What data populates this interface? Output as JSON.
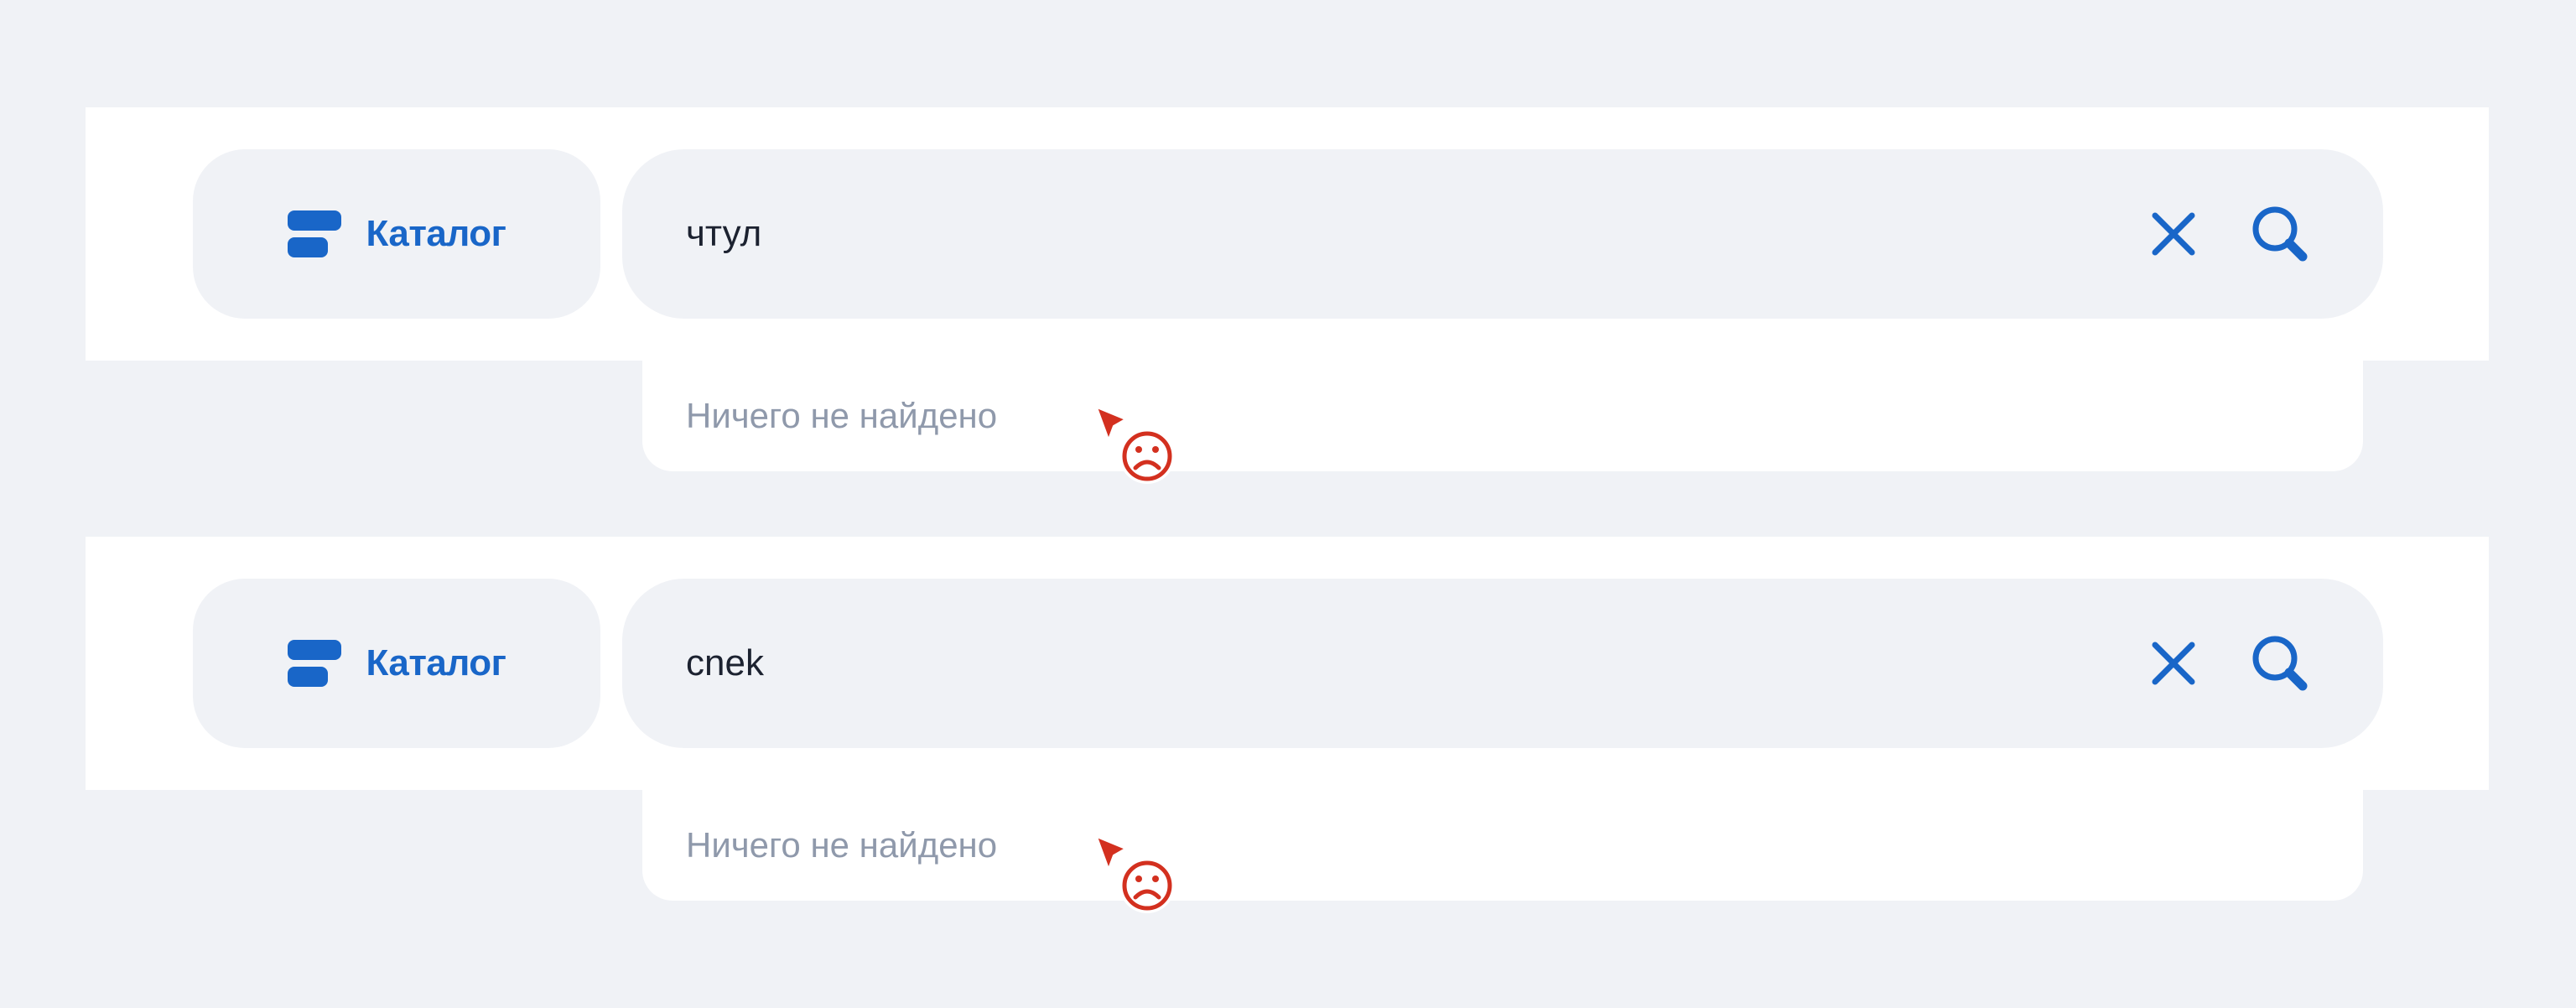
{
  "colors": {
    "background": "#f0f2f6",
    "panel": "#ffffff",
    "accent": "#1966c8",
    "error_cursor": "#d3301f",
    "muted_text": "#8f99ab"
  },
  "search_bars": [
    {
      "catalog_label": "Каталог",
      "catalog_icon": "catalog-icon",
      "query": "чтул",
      "clear_icon": "close-icon",
      "search_icon": "search-icon",
      "dropdown_text": "Ничего не найдено",
      "cursor_icon": "sad-face-cursor-icon"
    },
    {
      "catalog_label": "Каталог",
      "catalog_icon": "catalog-icon",
      "query": "cnek",
      "clear_icon": "close-icon",
      "search_icon": "search-icon",
      "dropdown_text": "Ничего не найдено",
      "cursor_icon": "sad-face-cursor-icon"
    }
  ]
}
